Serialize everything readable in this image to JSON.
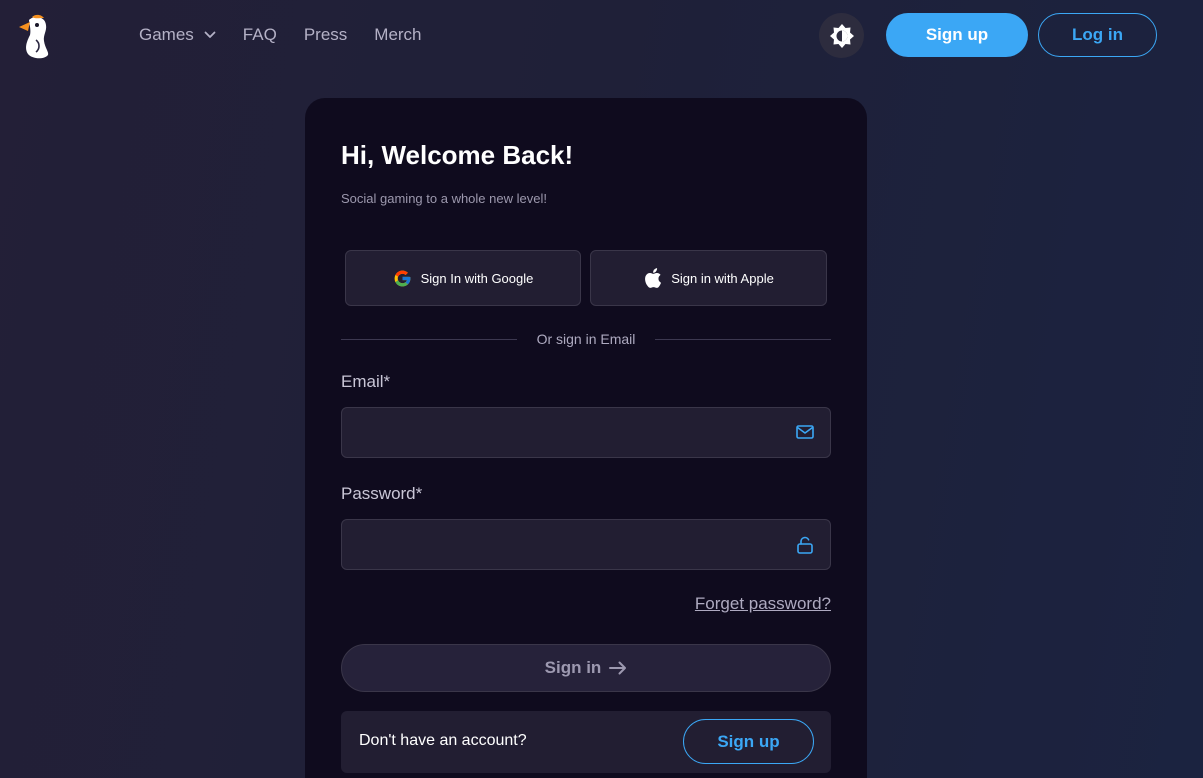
{
  "header": {
    "nav": [
      {
        "label": "Games",
        "has_dropdown": true
      },
      {
        "label": "FAQ"
      },
      {
        "label": "Press"
      },
      {
        "label": "Merch"
      }
    ],
    "signup_label": "Sign up",
    "login_label": "Log in",
    "icons": {
      "logo": "bird-logo-icon",
      "theme": "brightness-icon",
      "dropdown": "chevron-down-icon"
    }
  },
  "login": {
    "title": "Hi, Welcome Back!",
    "subtitle": "Social gaming to a whole new level!",
    "google_label": "Sign In with Google",
    "apple_label": "Sign in with Apple",
    "divider_text": "Or sign in Email",
    "email_label": "Email*",
    "email_value": "",
    "password_label": "Password*",
    "password_value": "",
    "forgot_label": "Forget password?",
    "signin_label": "Sign in",
    "no_account_text": "Don't have an account?",
    "signup_label": "Sign up",
    "icons": {
      "google": "google-icon",
      "apple": "apple-icon",
      "email": "mail-icon",
      "password": "unlock-icon",
      "signin": "arrow-right-icon"
    }
  },
  "colors": {
    "accent": "#3ba7f5",
    "card_bg": "#0f0b1e",
    "input_bg": "#221e32",
    "page_bg": "#1f2038"
  }
}
